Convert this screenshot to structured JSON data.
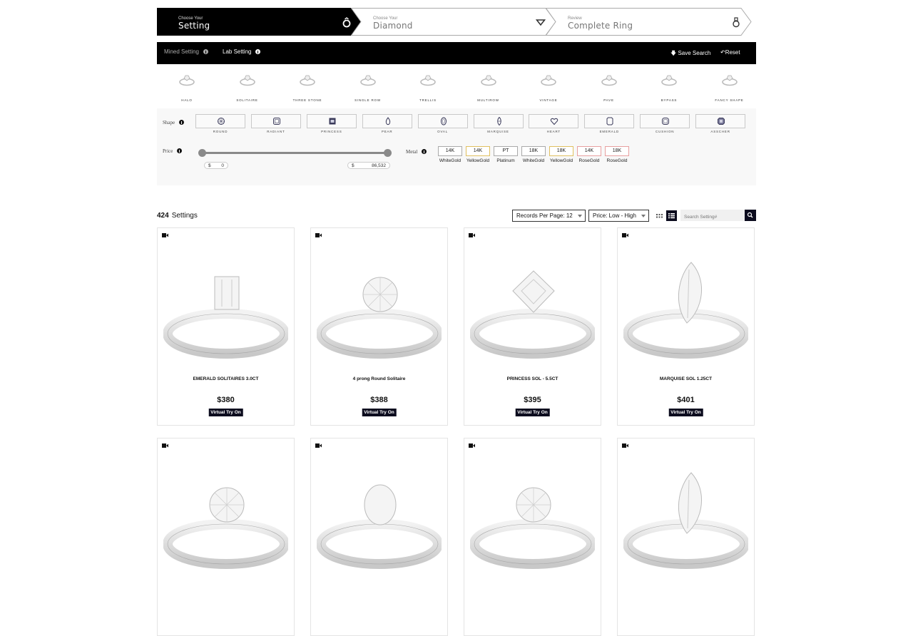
{
  "steps": [
    {
      "small": "Choose Your",
      "big": "Setting",
      "icon": "ring-icon",
      "active": true
    },
    {
      "small": "Choose Your",
      "big": "Diamond",
      "icon": "diamond-icon",
      "active": false
    },
    {
      "small": "Review",
      "big": "Complete Ring",
      "icon": "complete-ring-icon",
      "active": false
    }
  ],
  "topbar": {
    "tabs": [
      {
        "label": "Mined Setting",
        "active": false
      },
      {
        "label": "Lab Setting",
        "active": true
      }
    ],
    "save_label": "Save Search",
    "reset_label": "Reset"
  },
  "ring_styles": [
    "HALO",
    "SOLITAIRE",
    "THREE STONE",
    "SINGLE ROW",
    "TRELLIS",
    "MULTIROW",
    "VINTAGE",
    "PAVE",
    "BYPASS",
    "FANCY SHAPE"
  ],
  "filters": {
    "shape_label": "Shape",
    "shapes": [
      "ROUND",
      "RADIANT",
      "PRINCESS",
      "PEAR",
      "OVAL",
      "MARQUISE",
      "HEART",
      "EMERALD",
      "CUSHION",
      "ASSCHER"
    ],
    "price_label": "Price",
    "price": {
      "currency": "$",
      "min": "0",
      "max": "86,532"
    },
    "metal_label": "Metal",
    "metals": [
      {
        "karat": "14K",
        "name": "WhiteGold",
        "color": "#aaaaaa"
      },
      {
        "karat": "14K",
        "name": "YellowGold",
        "color": "#e0c060"
      },
      {
        "karat": "PT",
        "name": "Platinum",
        "color": "#aaaaaa"
      },
      {
        "karat": "18K",
        "name": "WhiteGold",
        "color": "#aaaaaa"
      },
      {
        "karat": "18K",
        "name": "YellowGold",
        "color": "#e0c060"
      },
      {
        "karat": "14K",
        "name": "RoseGold",
        "color": "#e8a0a0"
      },
      {
        "karat": "18K",
        "name": "RoseGold",
        "color": "#e8a0a0"
      }
    ]
  },
  "results": {
    "count": "424",
    "count_label": "Settings",
    "records_per_page": "Records Per Page: 12",
    "sort": "Price: Low - High",
    "search_placeholder": "Search Setting#"
  },
  "products": [
    {
      "name": "EMERALD SOLITAIRES 3.0CT",
      "price": "$380",
      "cta": "Virtual Try On",
      "shape": "emerald"
    },
    {
      "name": "4 prong Round Solitaire",
      "price": "$388",
      "cta": "Virtual Try On",
      "shape": "round"
    },
    {
      "name": "PRINCESS SOL - 5.5CT",
      "price": "$395",
      "cta": "Virtual Try On",
      "shape": "princess"
    },
    {
      "name": "MARQUISE SOL 1.25CT",
      "price": "$401",
      "cta": "Virtual Try On",
      "shape": "marquise"
    },
    {
      "name": "",
      "price": "",
      "cta": "",
      "shape": "round"
    },
    {
      "name": "",
      "price": "",
      "cta": "",
      "shape": "oval"
    },
    {
      "name": "",
      "price": "",
      "cta": "",
      "shape": "round"
    },
    {
      "name": "",
      "price": "",
      "cta": "",
      "shape": "marquise"
    }
  ]
}
